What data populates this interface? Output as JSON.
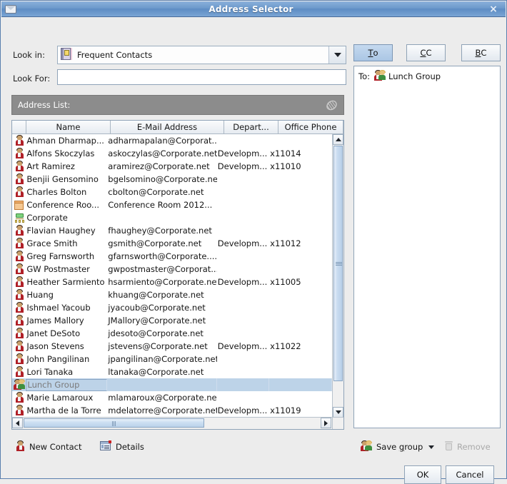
{
  "window": {
    "title": "Address Selector",
    "title_icon": "envelope-icon",
    "close_label": "×"
  },
  "form": {
    "lookin_label": "Look in:",
    "lookin_value": "Frequent Contacts",
    "lookin_icon": "address-book-icon",
    "lookfor_label": "Look For:",
    "lookfor_value": "",
    "lookfor_placeholder": ""
  },
  "recipient_buttons": [
    {
      "name": "to-button",
      "mnemonic": "T",
      "rest": "o",
      "active": true
    },
    {
      "name": "cc-button",
      "mnemonic": "C",
      "rest": "C",
      "active": false
    },
    {
      "name": "bcc-button",
      "mnemonic": "B",
      "rest": "C",
      "active": false
    }
  ],
  "recipients": {
    "prefix": "To:",
    "entries": [
      {
        "icon": "group-icon",
        "name": "Lunch Group"
      }
    ]
  },
  "address_list": {
    "bar_label": "Address List:",
    "bar_icon": "search-directory-icon",
    "columns": [
      "",
      "Name",
      "E-Mail Address",
      "Depart...",
      "Office Phone"
    ],
    "rows": [
      {
        "icon": "person-icon",
        "name": "Ahman Dharmap...",
        "email": "adharmapalan@Corporat...",
        "dept": "",
        "phone": "",
        "selected": false
      },
      {
        "icon": "person-icon",
        "name": "Alfons Skoczylas",
        "email": "askoczylas@Corporate.net",
        "dept": "Developm...",
        "phone": "x11014",
        "selected": false
      },
      {
        "icon": "person-icon",
        "name": "Art Ramirez",
        "email": "aramirez@Corporate.net",
        "dept": "Developm...",
        "phone": "x11010",
        "selected": false
      },
      {
        "icon": "person-icon",
        "name": "Benjii Gensomino",
        "email": "bgelsomino@Corporate.net",
        "dept": "",
        "phone": "",
        "selected": false
      },
      {
        "icon": "person-icon",
        "name": "Charles Bolton",
        "email": "cbolton@Corporate.net",
        "dept": "",
        "phone": "",
        "selected": false
      },
      {
        "icon": "resource-icon",
        "name": "Conference Roo...",
        "email": "Conference Room 2012...",
        "dept": "",
        "phone": "",
        "selected": false
      },
      {
        "icon": "network-icon",
        "name": "Corporate",
        "email": "",
        "dept": "",
        "phone": "",
        "selected": false
      },
      {
        "icon": "person-icon",
        "name": "Flavian Haughey",
        "email": "fhaughey@Corporate.net",
        "dept": "",
        "phone": "",
        "selected": false
      },
      {
        "icon": "person-icon",
        "name": "Grace Smith",
        "email": "gsmith@Corporate.net",
        "dept": "Developm...",
        "phone": "x11012",
        "selected": false
      },
      {
        "icon": "person-icon",
        "name": "Greg Farnsworth",
        "email": "gfarnsworth@Corporate....",
        "dept": "",
        "phone": "",
        "selected": false
      },
      {
        "icon": "person-icon",
        "name": "GW Postmaster",
        "email": "gwpostmaster@Corporat...",
        "dept": "",
        "phone": "",
        "selected": false
      },
      {
        "icon": "person-icon",
        "name": "Heather Sarmiento",
        "email": "hsarmiento@Corporate.net",
        "dept": "Developm...",
        "phone": "x11005",
        "selected": false
      },
      {
        "icon": "person-icon",
        "name": "Huang",
        "email": "khuang@Corporate.net",
        "dept": "",
        "phone": "",
        "selected": false
      },
      {
        "icon": "person-icon",
        "name": "Ishmael Yacoub",
        "email": "jyacoub@Corporate.net",
        "dept": "",
        "phone": "",
        "selected": false
      },
      {
        "icon": "person-icon",
        "name": "James Mallory",
        "email": "JMallory@Corporate.net",
        "dept": "",
        "phone": "",
        "selected": false
      },
      {
        "icon": "person-icon",
        "name": "Janet DeSoto",
        "email": "jdesoto@Corporate.net",
        "dept": "",
        "phone": "",
        "selected": false
      },
      {
        "icon": "person-icon",
        "name": "Jason Stevens",
        "email": "jstevens@Corporate.net",
        "dept": "Developm...",
        "phone": "x11022",
        "selected": false
      },
      {
        "icon": "person-icon",
        "name": "John Pangilinan",
        "email": "jpangilinan@Corporate.net",
        "dept": "",
        "phone": "",
        "selected": false
      },
      {
        "icon": "person-icon",
        "name": "Lori Tanaka",
        "email": "ltanaka@Corporate.net",
        "dept": "",
        "phone": "",
        "selected": false
      },
      {
        "icon": "group-icon",
        "name": "Lunch Group",
        "email": "",
        "dept": "",
        "phone": "",
        "selected": true
      },
      {
        "icon": "person-icon",
        "name": "Marie Lamaroux",
        "email": "mlamaroux@Corporate.net",
        "dept": "",
        "phone": "",
        "selected": false
      },
      {
        "icon": "person-icon",
        "name": "Martha de la Torre",
        "email": "mdelatorre@Corporate.net",
        "dept": "Developm...",
        "phone": "x11019",
        "selected": false
      }
    ]
  },
  "actions": {
    "new_contact": {
      "label": "New Contact",
      "icon": "person-icon",
      "enabled": true
    },
    "details": {
      "label": "Details",
      "icon": "details-icon",
      "enabled": true
    },
    "save_group": {
      "label_pre": "Save ",
      "label_mnem": "g",
      "label_post": "roup",
      "icon": "group-icon",
      "enabled": true,
      "has_dropdown": true
    },
    "remove": {
      "label": "Remove",
      "icon": "trash-icon",
      "enabled": false
    }
  },
  "dialog_buttons": {
    "ok": "OK",
    "cancel": "Cancel"
  },
  "colors": {
    "titlebar": "#6f9bcd",
    "selection": "#bdd3e8",
    "list_bar": "#8c8c8c",
    "face": "#ececec",
    "disabled_text": "#a9a9a9"
  }
}
